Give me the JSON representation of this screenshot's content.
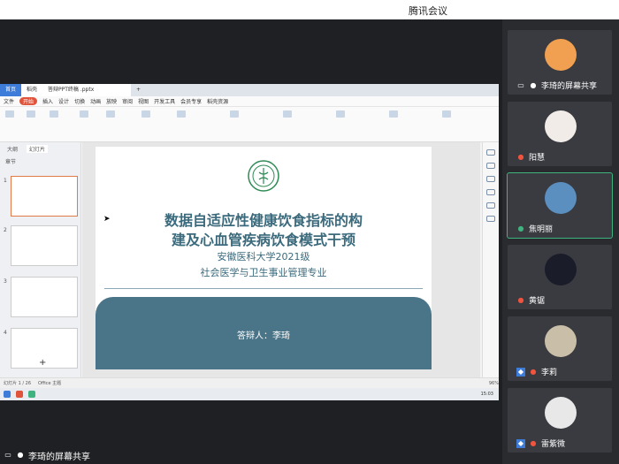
{
  "app_title": "腾讯会议",
  "share_label": "李琦的屏幕共享",
  "participants": [
    {
      "name": "李琦的屏幕共享",
      "mic": "on"
    },
    {
      "name": "阳慧",
      "mic": "muted"
    },
    {
      "name": "焦明丽",
      "mic": "active"
    },
    {
      "name": "黄锯",
      "mic": "muted"
    },
    {
      "name": "李莉",
      "mic": "muted"
    },
    {
      "name": "雷紫微",
      "mic": "muted"
    }
  ],
  "wps": {
    "tab_home": "首页",
    "tab_file": "稻壳",
    "tab_doc": "答辩PPT终稿 .pptx",
    "menu": [
      "文件",
      "开始",
      "插入",
      "设计",
      "切换",
      "动画",
      "放映",
      "审阅",
      "视图",
      "开发工具",
      "会员专享",
      "稻壳资源"
    ],
    "menu_active": "开始",
    "panel_tabs": [
      "大纲",
      "幻灯片"
    ],
    "panel_label": "章节",
    "status_left": "幻灯片 1 / 26",
    "status_theme": "Office 主题",
    "status_zoom": "96%",
    "time": "15:03"
  },
  "slide": {
    "title_line1": "数据自适应性健康饮食指标的构",
    "title_line2": "建及心血管疾病饮食模式干预",
    "subtitle1": "安徽医科大学2021级",
    "subtitle2": "社会医学与卫生事业管理专业",
    "defender": "答辩人：李琦"
  },
  "thumb_numbers": [
    "1",
    "2",
    "3",
    "4"
  ],
  "colors": {
    "accent": "#4a7487",
    "title": "#3a6a7c",
    "wps_blue": "#3d7cd8",
    "menu_active": "#e0543b"
  }
}
